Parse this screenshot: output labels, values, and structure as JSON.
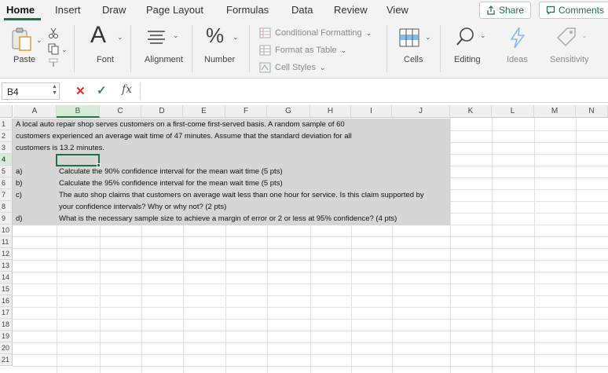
{
  "tabs": [
    "Home",
    "Insert",
    "Draw",
    "Page Layout",
    "Formulas",
    "Data",
    "Review",
    "View"
  ],
  "actions": {
    "share": "Share",
    "comments": "Comments"
  },
  "ribbon": {
    "paste": "Paste",
    "font": "Font",
    "alignment": "Alignment",
    "number": "Number",
    "conditional_formatting": "Conditional Formatting",
    "format_as_table": "Format as Table",
    "cell_styles": "Cell Styles",
    "cells": "Cells",
    "editing": "Editing",
    "ideas": "Ideas",
    "sensitivity": "Sensitivity",
    "font_glyph": "A",
    "number_glyph": "%"
  },
  "formula_bar": {
    "name_box": "B4",
    "fx": "fx",
    "value": ""
  },
  "columns": [
    "A",
    "B",
    "C",
    "D",
    "E",
    "F",
    "G",
    "H",
    "I",
    "J",
    "K",
    "L",
    "M",
    "N"
  ],
  "selected_column": "B",
  "rows": [
    "1",
    "2",
    "3",
    "4",
    "5",
    "6",
    "7",
    "8",
    "9",
    "10",
    "11",
    "12",
    "13",
    "14",
    "15",
    "16",
    "17",
    "18",
    "19",
    "20",
    "21"
  ],
  "selected_row": "4",
  "cells": {
    "a1": "A local auto repair shop serves customers on a first-come first-served basis.  A random sample of 60",
    "a2": "customers experienced an average wait time of 47 minutes.  Assume that the standard deviation for all",
    "a3": "customers is 13.2 minutes.",
    "a5": "a)",
    "a6": "b)",
    "a7": "c)",
    "a9": "d)",
    "b5": "Calculate the 90% confidence interval for the mean wait time (5 pts)",
    "b6": "Calculate the 95% confidence interval for the mean wait time (5 pts)",
    "b7": "The auto shop claims that customers on average wait less than one hour for service.  Is this claim supported by",
    "b8": "your confidence intervals?  Why or why not? (2 pts)",
    "b9": "What is the necessary sample size to achieve a margin of error or 2 or less at 95% confidence? (4 pts)"
  },
  "colors": {
    "accent": "#1e7145",
    "shade": "#d6d6d6",
    "error_red": "#d0312d"
  }
}
